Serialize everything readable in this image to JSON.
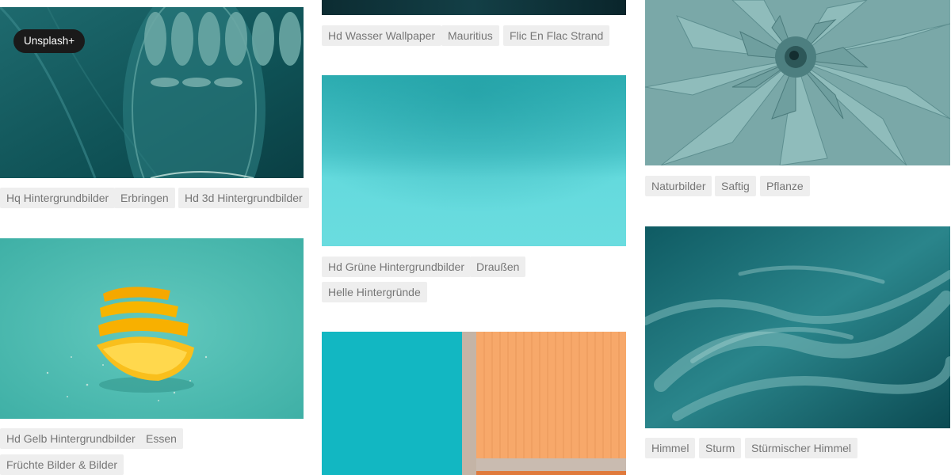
{
  "badge": {
    "label": "Unsplash+"
  },
  "columns": [
    {
      "photos": [
        {
          "name": "teal-3d-arches",
          "description": "3D teal arches",
          "tags": [
            "Hq Hintergrundbilder",
            "Erbringen",
            "Hd 3d Hintergrundbilder"
          ]
        },
        {
          "name": "orange-slices",
          "description": "Orange slices on teal",
          "tags": [
            "Hd Gelb Hintergrundbilder",
            "Essen",
            "Früchte Bilder & Bilder"
          ]
        }
      ]
    },
    {
      "photos": [
        {
          "name": "dark-water",
          "description": "Dark water",
          "tags": [
            "Hd Wasser Wallpaper",
            "Mauritius",
            "Flic En Flac Strand"
          ]
        },
        {
          "name": "turquoise-backdrop",
          "description": "Turquoise backdrop",
          "tags": [
            "Hd Grüne Hintergrundbilder",
            "Draußen",
            "Helle Hintergründe"
          ]
        },
        {
          "name": "pool-and-orange-wall",
          "description": "Pool and orange wall",
          "tags": []
        }
      ]
    },
    {
      "photos": [
        {
          "name": "agave-succulent",
          "description": "Agave succulent",
          "tags": [
            "Naturbilder",
            "Saftig",
            "Pflanze"
          ]
        },
        {
          "name": "stormy-sky",
          "description": "Stormy teal sky",
          "tags": [
            "Himmel",
            "Sturm",
            "Stürmischer Himmel"
          ]
        }
      ]
    }
  ],
  "colors": {
    "tag_background": "#eeeeee",
    "tag_text": "#767676",
    "badge_background": "#1a1a1a"
  }
}
